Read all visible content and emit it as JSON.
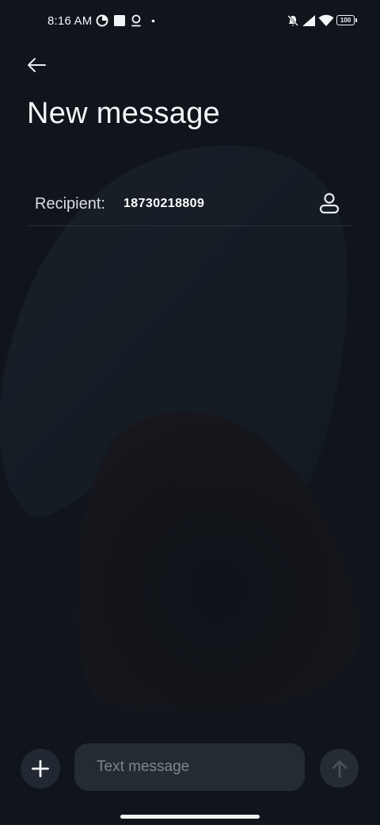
{
  "status_bar": {
    "time": "8:16 AM",
    "battery": "100",
    "left_icons": [
      "data-saver-icon",
      "square-notification-icon",
      "location-pin-icon",
      "dot-icon"
    ],
    "right_icons": [
      "bell-off-icon",
      "signal-icon",
      "wifi-icon",
      "battery-icon"
    ]
  },
  "header": {
    "back_icon": "arrow-left-icon",
    "title": "New message"
  },
  "recipient": {
    "label": "Recipient:",
    "value": "18730218809",
    "contact_icon": "person-icon"
  },
  "composer": {
    "attach_icon": "plus-icon",
    "placeholder": "Text message",
    "value": "",
    "send_icon": "arrow-up-icon"
  },
  "colors": {
    "background": "#10151c",
    "input_background": "#252b33",
    "button_background": "#222831",
    "divider": "#2a3039"
  }
}
